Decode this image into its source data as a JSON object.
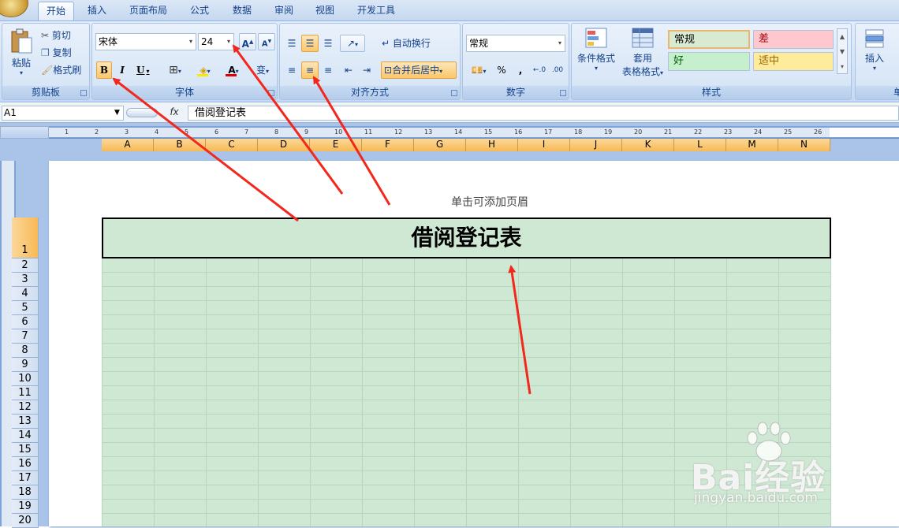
{
  "tabs": [
    {
      "label": "开始",
      "active": true
    },
    {
      "label": "插入"
    },
    {
      "label": "页面布局"
    },
    {
      "label": "公式"
    },
    {
      "label": "数据"
    },
    {
      "label": "审阅"
    },
    {
      "label": "视图"
    },
    {
      "label": "开发工具"
    }
  ],
  "clipboard": {
    "paste": "粘贴",
    "cut": "剪切",
    "copy": "复制",
    "format_painter": "格式刷",
    "group_label": "剪贴板"
  },
  "font": {
    "name": "宋体",
    "size": "24",
    "bold": "B",
    "italic": "I",
    "underline": "U",
    "font_color_glyph": "A",
    "grow": "A",
    "shrink": "A",
    "phonetic": "变",
    "group_label": "字体"
  },
  "alignment": {
    "wrap": "自动换行",
    "merge": "合并后居中",
    "group_label": "对齐方式"
  },
  "number": {
    "format": "常规",
    "percent": "%",
    "comma": ",",
    "group_label": "数字"
  },
  "styles": {
    "conditional": "条件格式",
    "table_line1": "套用",
    "table_line2": "表格格式",
    "normal": "常规",
    "bad": "差",
    "good": "好",
    "neutral": "适中",
    "group_label": "样式"
  },
  "cells": {
    "insert": "插入",
    "group_label": "单"
  },
  "formula_bar": {
    "name_box": "A1",
    "fx": "fx",
    "content": "借阅登记表"
  },
  "columns": [
    "A",
    "B",
    "C",
    "D",
    "E",
    "F",
    "G",
    "H",
    "I",
    "J",
    "K",
    "L",
    "M",
    "N"
  ],
  "ruler_h": [
    "1",
    "2",
    "3",
    "4",
    "5",
    "6",
    "7",
    "8",
    "9",
    "10",
    "11",
    "12",
    "13",
    "14",
    "15",
    "16",
    "17",
    "18",
    "19",
    "20",
    "21",
    "22",
    "23",
    "24",
    "25",
    "26"
  ],
  "rows": [
    "1",
    "2",
    "3",
    "4",
    "5",
    "6",
    "7",
    "8",
    "9",
    "10",
    "11",
    "12",
    "13",
    "14",
    "15",
    "16",
    "17",
    "18",
    "19",
    "20"
  ],
  "header_hint": "单击可添加页眉",
  "title_cell": "借阅登记表",
  "watermark": {
    "brand": "Bai经验",
    "url": "jingyan.baidu.com"
  },
  "colors": {
    "accent": "#f8b955",
    "title_fill": "#cfe8d3",
    "arrow": "#f2281c"
  }
}
